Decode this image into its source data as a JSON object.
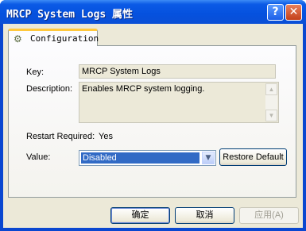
{
  "window": {
    "title": "MRCP System Logs 属性",
    "help_glyph": "?",
    "close_glyph": "✕"
  },
  "tab": {
    "label": "Configuration",
    "icon": "gear-icon"
  },
  "form": {
    "key_label": "Key:",
    "key_value": "MRCP System Logs",
    "description_label": "Description:",
    "description_value": "Enables MRCP system logging.",
    "restart_label": "Restart Required:",
    "restart_value": "Yes",
    "value_label": "Value:",
    "value_selected": "Disabled",
    "restore_default_label": "Restore Default"
  },
  "buttons": {
    "ok": "确定",
    "cancel": "取消",
    "apply": "应用(A)"
  }
}
